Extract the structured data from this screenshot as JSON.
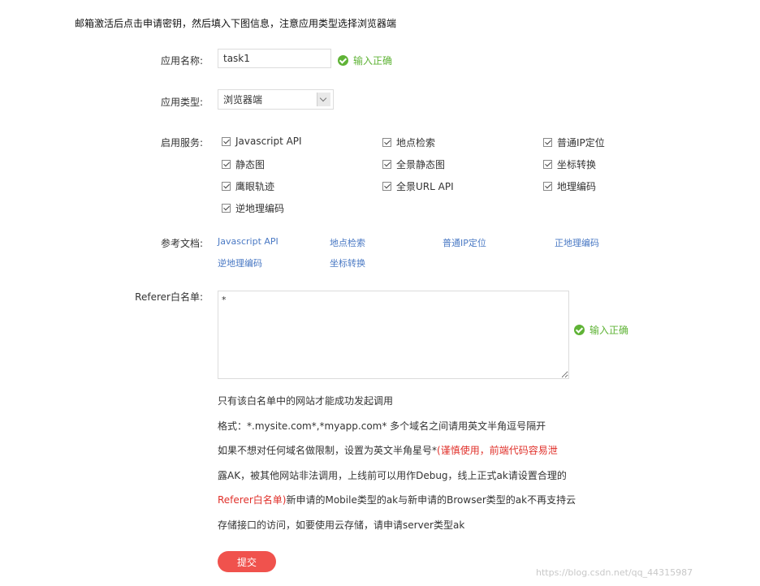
{
  "intro_text": "邮箱激活后点击申请密钥，然后填入下图信息，注意应用类型选择浏览器端",
  "app_name": {
    "label": "应用名称:",
    "value": "task1",
    "status": "输入正确"
  },
  "app_type": {
    "label": "应用类型:",
    "selected": "浏览器端"
  },
  "services": {
    "label": "启用服务:",
    "items": [
      "Javascript API",
      "地点检索",
      "普通IP定位",
      "静态图",
      "全景静态图",
      "坐标转换",
      "鹰眼轨迹",
      "全景URL API",
      "地理编码",
      "逆地理编码"
    ]
  },
  "docs": {
    "label": "参考文档:",
    "links": [
      "Javascript API",
      "地点检索",
      "普通IP定位",
      "正地理编码",
      "逆地理编码",
      "坐标转换"
    ]
  },
  "referer": {
    "label": "Referer白名单:",
    "value": "*",
    "status": "输入正确",
    "hint": "只有该白名单中的网站才能成功发起调用",
    "format_line": "格式：*.mysite.com*,*myapp.com* 多个域名之间请用英文半角逗号隔开",
    "note_line1_normal": "如果不想对任何域名做限制，设置为英文半角星号*",
    "note_line1_red": "(谨慎使用，前端代码容易泄",
    "note_line2_red": "露AK，被其他网站非法调用，上线前可以用作Debug，线上正式ak请设置合理的",
    "note_line3_red": "Referer白名单)",
    "note_line3_normal": "新申请的Mobile类型的ak与新申请的Browser类型的ak不再支持云",
    "note_line4": "存储接口的访问，如要使用云存储，请申请server类型ak"
  },
  "submit_label": "提交",
  "watermark": "https://blog.csdn.net/qq_44315987"
}
